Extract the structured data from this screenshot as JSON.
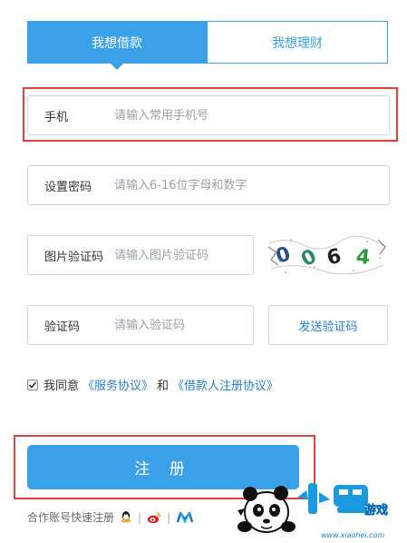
{
  "tabs": {
    "borrow": "我想借款",
    "invest": "我想理财"
  },
  "phone": {
    "label": "手机",
    "placeholder": "请输入常用手机号"
  },
  "password": {
    "label": "设置密码",
    "placeholder": "请输入6-16位字母和数字"
  },
  "image_captcha": {
    "label": "图片验证码",
    "placeholder": "请输入图片验证码",
    "captcha_text": "0064"
  },
  "sms_code": {
    "label": "验证码",
    "placeholder": "请输入验证码",
    "send_button": "发送验证码"
  },
  "agreement": {
    "prefix": "我同意",
    "service_link": "《服务协议》",
    "and": "和",
    "borrower_link": "《借款人注册协议》",
    "checked": true
  },
  "register_button": "注 册",
  "quick_login": {
    "label": "合作账号快速注册",
    "icons": [
      "qq-icon",
      "weibo-icon",
      "partner-icon"
    ]
  },
  "watermark": {
    "brand_text": "小黑游戏",
    "url": "www.xiaohei.com"
  },
  "colors": {
    "accent": "#3aa0e8",
    "link": "#2a7fc9",
    "highlight": "#e84040"
  }
}
